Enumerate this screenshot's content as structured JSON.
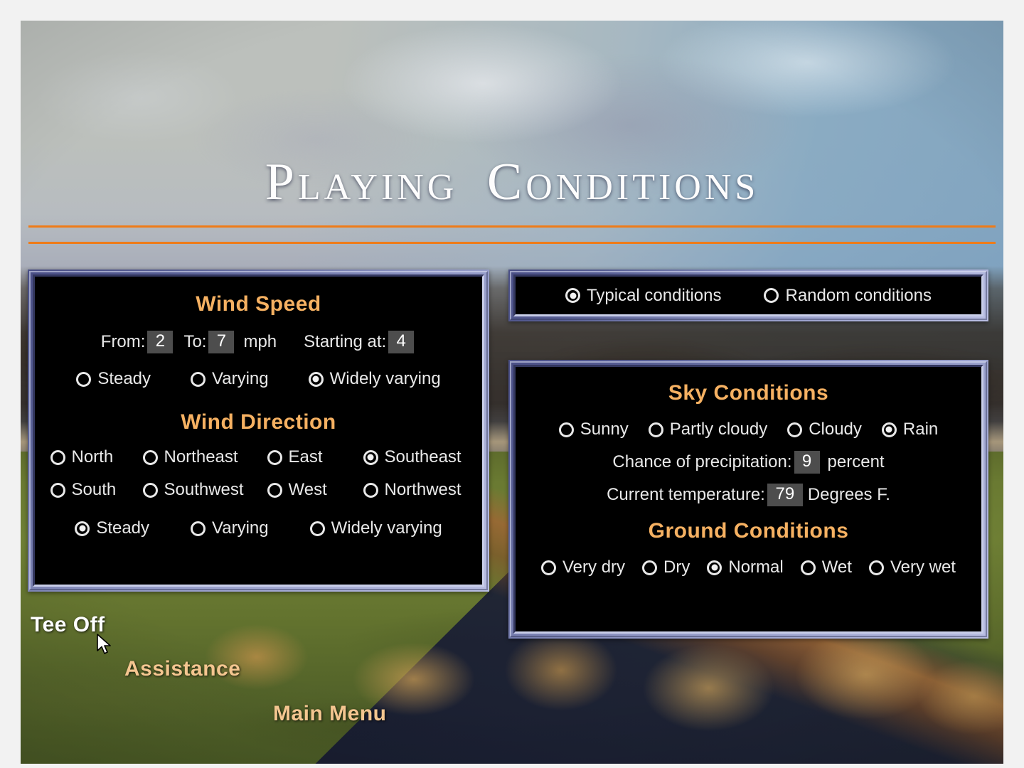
{
  "screen": {
    "title": "Playing Conditions"
  },
  "mode": {
    "options": [
      {
        "label": "Typical conditions",
        "selected": true
      },
      {
        "label": "Random conditions",
        "selected": false
      }
    ]
  },
  "wind_speed": {
    "title": "Wind Speed",
    "from_label": "From:",
    "from_value": "2",
    "to_label": "To:",
    "to_value": "7",
    "unit_label": "mph",
    "starting_label": "Starting at:",
    "starting_value": "4",
    "variability": [
      {
        "label": "Steady",
        "selected": false
      },
      {
        "label": "Varying",
        "selected": false
      },
      {
        "label": "Widely varying",
        "selected": true
      }
    ]
  },
  "wind_direction": {
    "title": "Wind Direction",
    "directions": [
      {
        "label": "North",
        "selected": false
      },
      {
        "label": "Northeast",
        "selected": false
      },
      {
        "label": "East",
        "selected": false
      },
      {
        "label": "Southeast",
        "selected": true
      },
      {
        "label": "South",
        "selected": false
      },
      {
        "label": "Southwest",
        "selected": false
      },
      {
        "label": "West",
        "selected": false
      },
      {
        "label": "Northwest",
        "selected": false
      }
    ],
    "variability": [
      {
        "label": "Steady",
        "selected": true
      },
      {
        "label": "Varying",
        "selected": false
      },
      {
        "label": "Widely varying",
        "selected": false
      }
    ]
  },
  "sky": {
    "title": "Sky Conditions",
    "options": [
      {
        "label": "Sunny",
        "selected": false
      },
      {
        "label": "Partly cloudy",
        "selected": false
      },
      {
        "label": "Cloudy",
        "selected": false
      },
      {
        "label": "Rain",
        "selected": true
      }
    ],
    "precip_label": "Chance of precipitation:",
    "precip_value": "9",
    "precip_unit": "percent",
    "temp_label": "Current temperature:",
    "temp_value": "79",
    "temp_unit": "Degrees F."
  },
  "ground": {
    "title": "Ground Conditions",
    "options": [
      {
        "label": "Very dry",
        "selected": false
      },
      {
        "label": "Dry",
        "selected": false
      },
      {
        "label": "Normal",
        "selected": true
      },
      {
        "label": "Wet",
        "selected": false
      },
      {
        "label": "Very wet",
        "selected": false
      }
    ]
  },
  "menu": {
    "tee_off": "Tee Off",
    "assistance": "Assistance",
    "main_menu": "Main Menu"
  },
  "colors": {
    "accent_orange": "#f6b162",
    "rule_orange": "#ef7b18",
    "menu_tan": "#f4c690",
    "panel_border": "#8f96c4",
    "field_bg": "#4d4d4d"
  }
}
